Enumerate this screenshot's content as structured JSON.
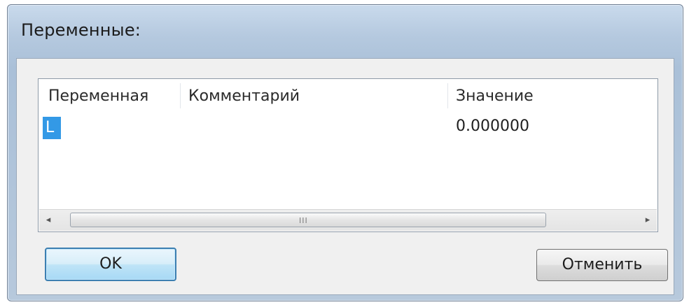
{
  "window": {
    "title": "Переменные:"
  },
  "table": {
    "columns": [
      "Переменная",
      "Комментарий",
      "Значение"
    ],
    "rows": [
      {
        "name": "L",
        "comment": "",
        "value": "0.000000"
      }
    ],
    "selection_color": "#3399e6",
    "scrollbar": {
      "left_arrow": "◂",
      "right_arrow": "▸",
      "grip": "III"
    }
  },
  "buttons": {
    "ok_label": "OK",
    "cancel_label": "Отменить"
  },
  "colors": {
    "default_button_border": "#3c7fb1",
    "frame": "#b5c9df"
  }
}
